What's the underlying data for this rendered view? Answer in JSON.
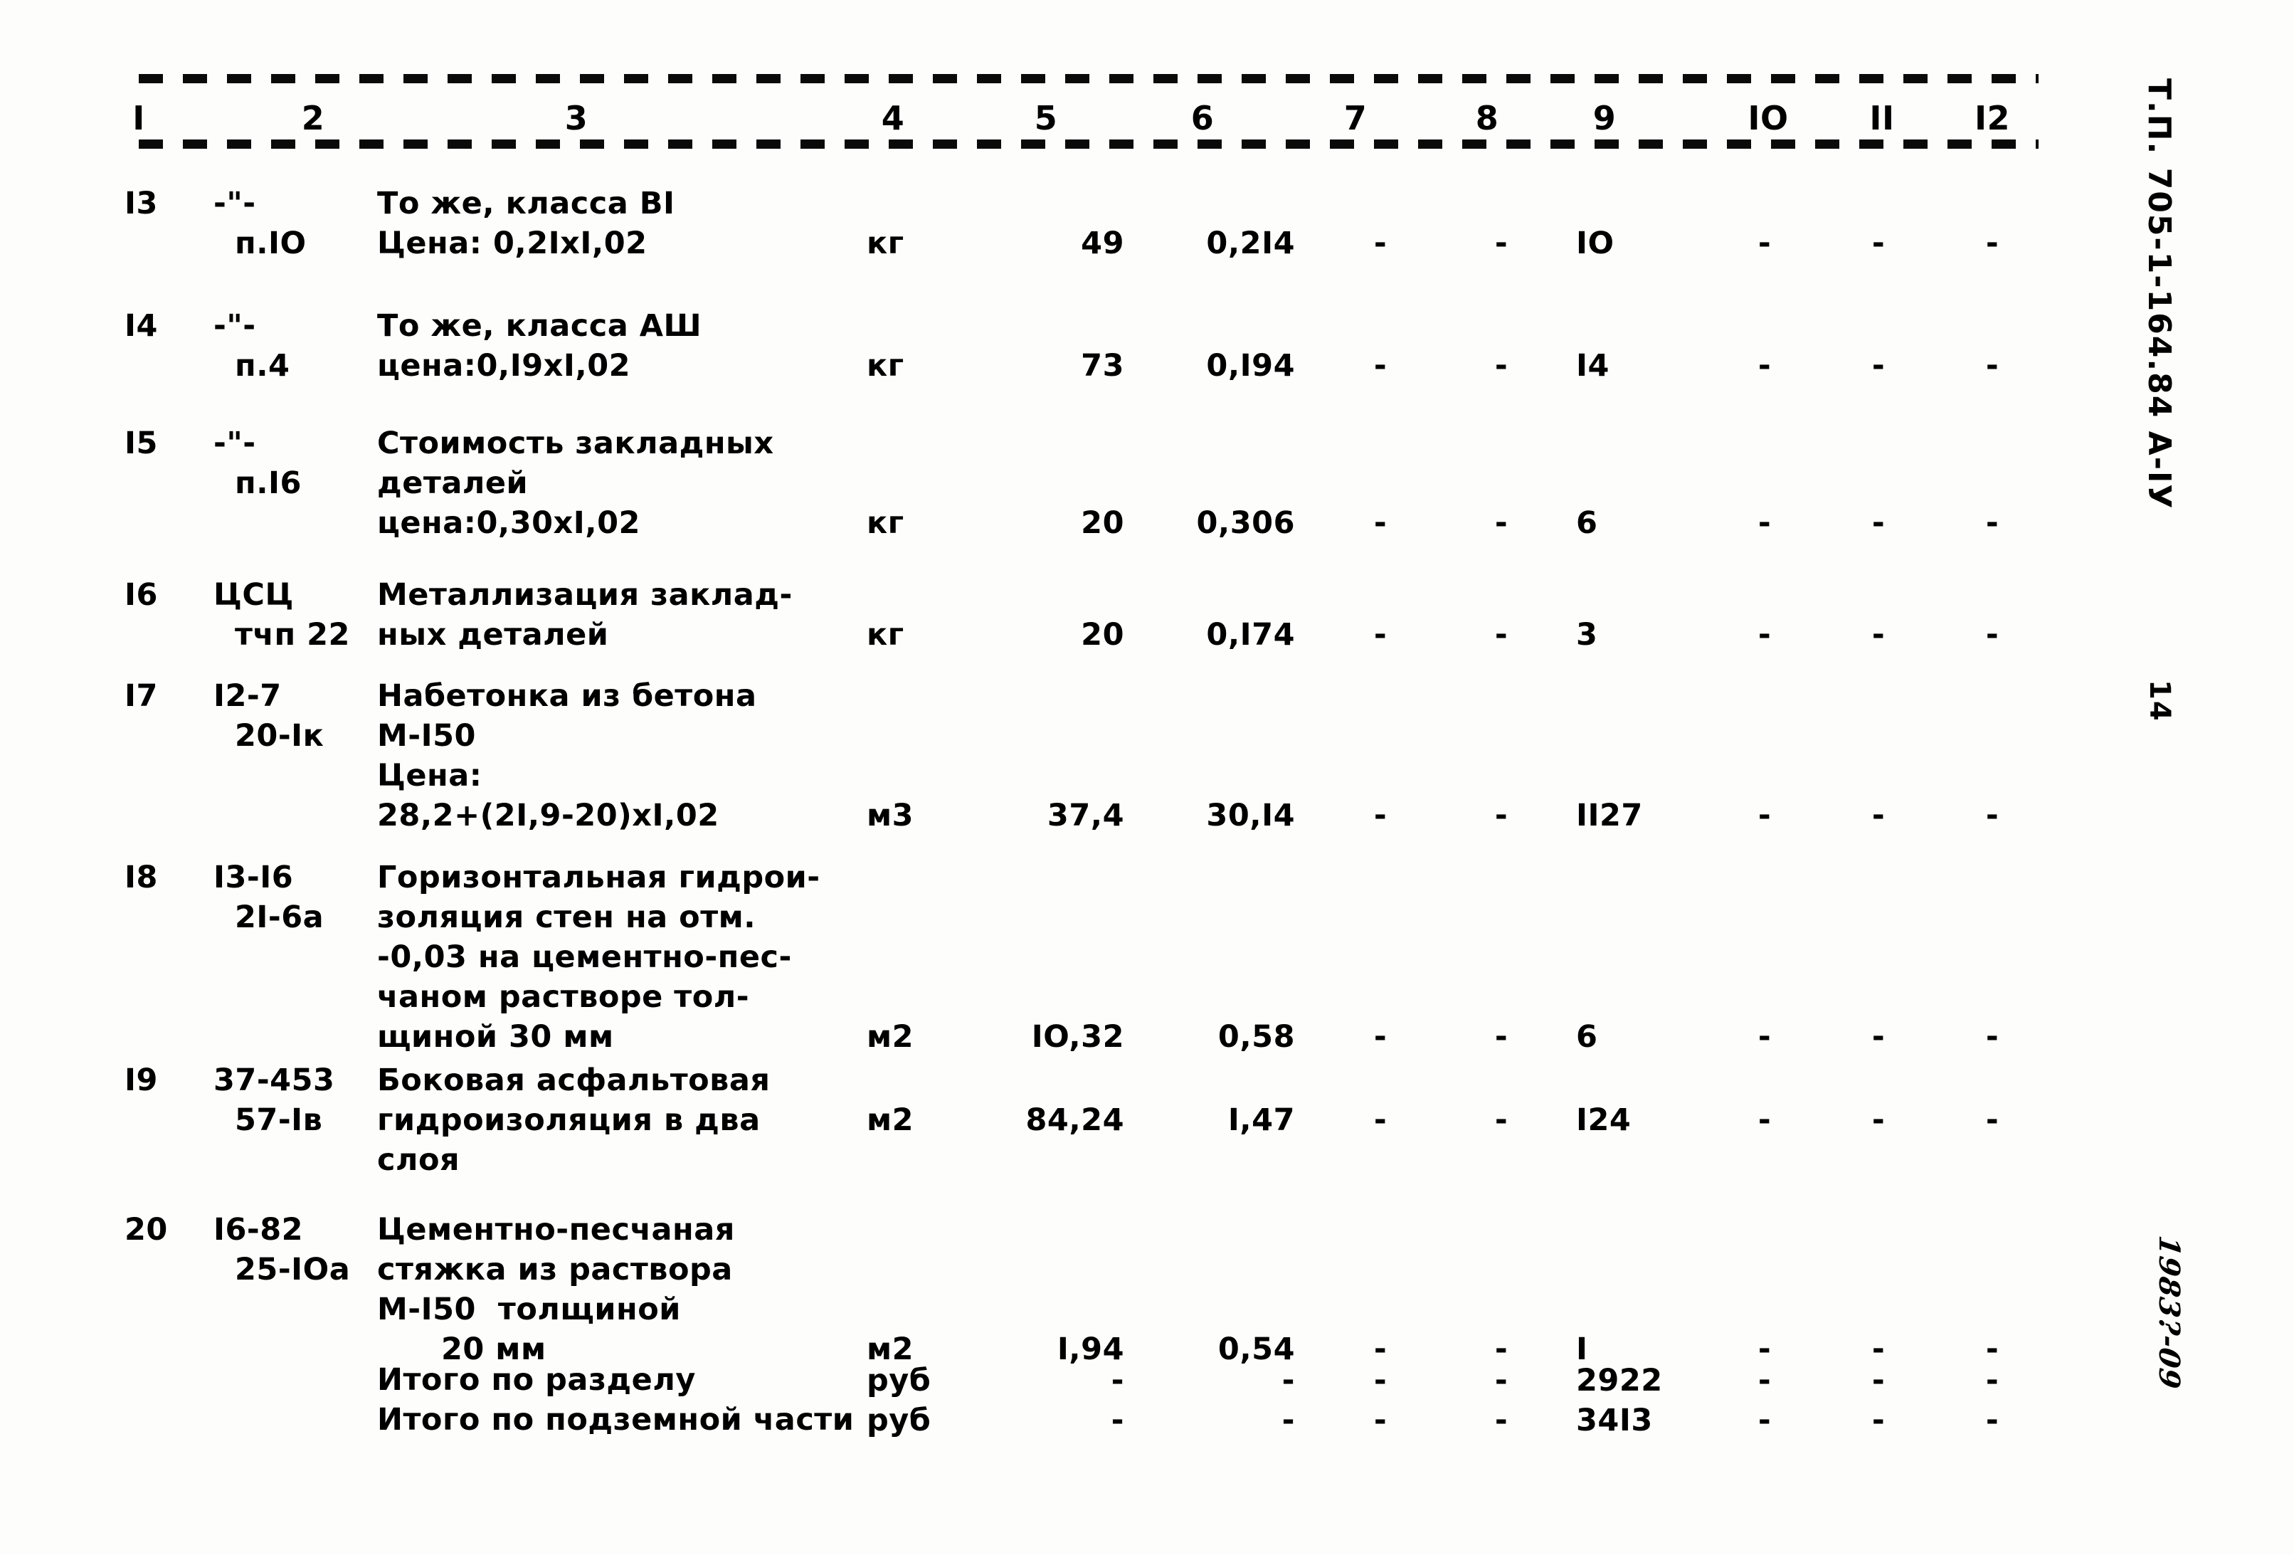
{
  "document": {
    "type": "scanned-estimate-table",
    "stamp_project": "Т.П. 705-1-164.84  А-IУ",
    "stamp_page": "14",
    "stamp_handwritten": "1983?-09"
  },
  "table": {
    "column_numbers": [
      "I",
      "2",
      "3",
      "4",
      "5",
      "6",
      "7",
      "8",
      "9",
      "IO",
      "II",
      "I2"
    ],
    "rows": [
      {
        "no": "I3",
        "code": [
          "-\"-",
          "п.IO"
        ],
        "desc": [
          "То же, класса ВI",
          "Цена: 0,2IхI,02"
        ],
        "desc_indent": [
          false,
          false
        ],
        "unit": "кг",
        "qty": "49",
        "price": "0,2I4",
        "c7": "-",
        "c8": "-",
        "total": "IO",
        "c10": "-",
        "c11": "-",
        "c12": "-"
      },
      {
        "no": "I4",
        "code": [
          "-\"-",
          "п.4"
        ],
        "desc": [
          "То же, класса АШ",
          "цена:0,I9хI,02"
        ],
        "desc_indent": [
          false,
          false
        ],
        "unit": "кг",
        "qty": "73",
        "price": "0,I94",
        "c7": "-",
        "c8": "-",
        "total": "I4",
        "c10": "-",
        "c11": "-",
        "c12": "-"
      },
      {
        "no": "I5",
        "code": [
          "-\"-",
          "п.I6"
        ],
        "desc": [
          "Стоимость закладных",
          "деталей",
          "цена:0,30хI,02"
        ],
        "desc_indent": [
          false,
          false,
          false
        ],
        "unit": "кг",
        "qty": "20",
        "price": "0,306",
        "c7": "-",
        "c8": "-",
        "total": "6",
        "c10": "-",
        "c11": "-",
        "c12": "-"
      },
      {
        "no": "I6",
        "code": [
          "ЦСЦ",
          "тчп 22"
        ],
        "desc": [
          "Металлизация заклад-",
          "ных деталей"
        ],
        "desc_indent": [
          false,
          false
        ],
        "unit": "кг",
        "qty": "20",
        "price": "0,I74",
        "c7": "-",
        "c8": "-",
        "total": "3",
        "c10": "-",
        "c11": "-",
        "c12": "-"
      },
      {
        "no": "I7",
        "code": [
          "I2-7",
          "20-Iк"
        ],
        "desc": [
          "Набетонка из бетона",
          "М-I50",
          "Цена:",
          "28,2+(2I,9-20)хI,02"
        ],
        "desc_indent": [
          false,
          false,
          false,
          false
        ],
        "unit": "м3",
        "qty": "37,4",
        "price": "30,I4",
        "c7": "-",
        "c8": "-",
        "total": "II27",
        "c10": "-",
        "c11": "-",
        "c12": "-"
      },
      {
        "no": "I8",
        "code": [
          "I3-I6",
          "2I-6а"
        ],
        "desc": [
          "Горизонтальная гидрои-",
          "золяция стен на отм.",
          "-0,03 на цементно-пес-",
          "чаном растворе тол-",
          "щиной 30 мм"
        ],
        "desc_indent": [
          false,
          false,
          false,
          false,
          false
        ],
        "unit": "м2",
        "qty": "IO,32",
        "price": "0,58",
        "c7": "-",
        "c8": "-",
        "total": "6",
        "c10": "-",
        "c11": "-",
        "c12": "-"
      },
      {
        "no": "I9",
        "code": [
          "37-453",
          "57-Iв"
        ],
        "desc": [
          "Боковая асфальтовая",
          "гидроизоляция в два",
          "слоя"
        ],
        "desc_indent": [
          false,
          false,
          false
        ],
        "unit": "м2",
        "qty": "84,24",
        "price": "I,47",
        "c7": "-",
        "c8": "-",
        "total": "I24",
        "c10": "-",
        "c11": "-",
        "c12": "-"
      },
      {
        "no": "20",
        "code": [
          "I6-82",
          "25-IOа"
        ],
        "desc": [
          "Цементно-песчаная",
          "стяжка из раствора",
          "М-I50  толщиной",
          "20 мм"
        ],
        "desc_indent": [
          false,
          false,
          false,
          true
        ],
        "unit": "м2",
        "qty": "I,94",
        "price": "0,54",
        "c7": "-",
        "c8": "-",
        "total": "I",
        "c10": "-",
        "c11": "-",
        "c12": "-"
      }
    ],
    "totals": [
      {
        "label": "Итого по разделу",
        "unit": "руб",
        "qty": "-",
        "price": "-",
        "c7": "-",
        "c8": "-",
        "total": "2922",
        "c10": "-",
        "c11": "-",
        "c12": "-"
      },
      {
        "label": "Итого по подземной части",
        "unit": "руб",
        "qty": "-",
        "price": "-",
        "c7": "-",
        "c8": "-",
        "total": "34I3",
        "c10": "-",
        "c11": "-",
        "c12": "-"
      }
    ]
  }
}
